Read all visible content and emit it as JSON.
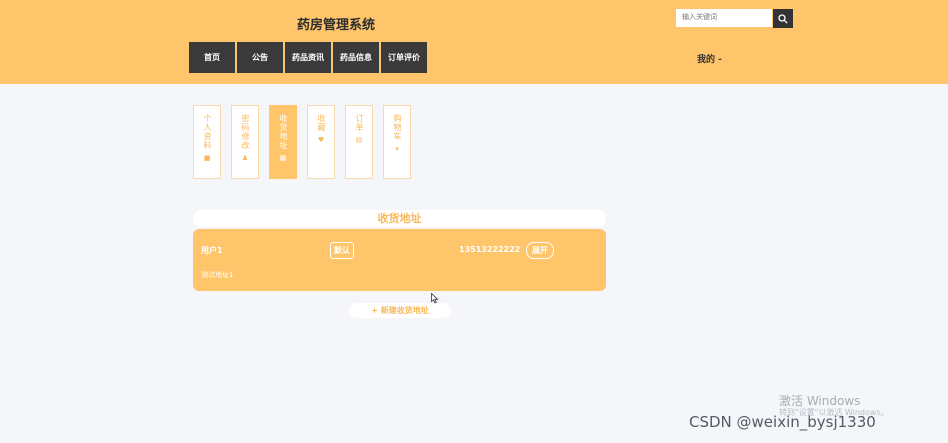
{
  "header": {
    "title": "药房管理系统",
    "search_placeholder": "输入关键词",
    "nav": [
      {
        "label": "首页",
        "width": 46
      },
      {
        "label": "公告",
        "width": 46
      },
      {
        "label": "药品资讯",
        "width": 46
      },
      {
        "label": "药品信息",
        "width": 46
      },
      {
        "label": "订单评价",
        "width": 46
      }
    ],
    "user_menu": "我的  -"
  },
  "tabs": [
    {
      "label": "个人资料",
      "icon": "home-icon",
      "glyph": "■",
      "active": false
    },
    {
      "label": "密码修改",
      "icon": "user-icon",
      "glyph": "♟",
      "active": false
    },
    {
      "label": "收货地址",
      "icon": "grid-icon",
      "glyph": "▦",
      "active": true
    },
    {
      "label": "收藏",
      "icon": "heart-icon",
      "glyph": "♥",
      "active": false
    },
    {
      "label": "订单",
      "icon": "file-icon",
      "glyph": "▤",
      "active": false
    },
    {
      "label": "购物车",
      "icon": "cart-icon",
      "glyph": "▾",
      "active": false
    }
  ],
  "address": {
    "section_title": "收货地址",
    "name": "用户1",
    "default_label": "默认",
    "phone": "13513222222",
    "expand_label": "展开",
    "detail": "测试地址1",
    "new_label": "+ 新建收货地址"
  },
  "watermark": {
    "line1": "激活 Windows",
    "line2": "转到\"设置\"以激活 Windows。",
    "csdn": "CSDN @weixin_bysj1330"
  },
  "colors": {
    "accent": "#fec56b",
    "nav": "#3a3a3a",
    "text_accent": "#fbb85a"
  }
}
